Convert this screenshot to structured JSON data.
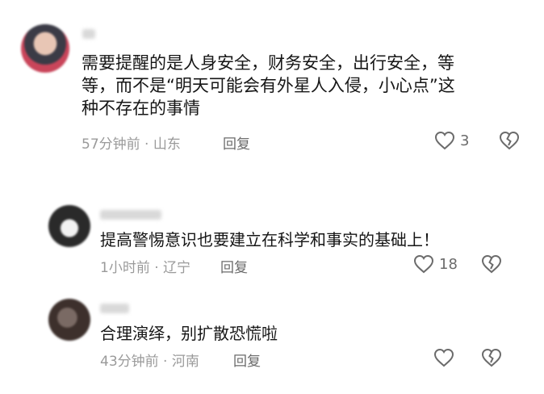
{
  "comments": [
    {
      "text_lines": [
        "需要提醒的是人身安全，财务安全，出行安全，等",
        "等，而不是“明天可能会有外星人入侵，小心点”这",
        "种不存在的事情"
      ],
      "time": "57分钟前",
      "location": "山东",
      "reply_label": "回复",
      "likes": "3"
    },
    {
      "text_lines": [
        "提高警惕意识也要建立在科学和事实的基础上！"
      ],
      "time": "1小时前",
      "location": "辽宁",
      "reply_label": "回复",
      "likes": "18"
    },
    {
      "text_lines": [
        "合理演绎，别扩散恐慌啦"
      ],
      "time": "43分钟前",
      "location": "河南",
      "reply_label": "回复",
      "likes": ""
    }
  ],
  "icons": {
    "like": "heart-outline-icon",
    "dislike": "broken-heart-outline-icon"
  },
  "separator": " · "
}
